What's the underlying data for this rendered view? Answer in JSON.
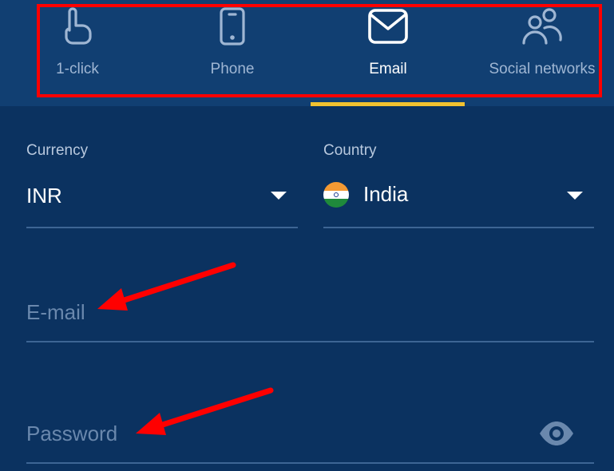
{
  "tabs": [
    {
      "label": "1-click",
      "icon": "hand-pointer-icon",
      "active": false
    },
    {
      "label": "Phone",
      "icon": "phone-icon",
      "active": false
    },
    {
      "label": "Email",
      "icon": "envelope-icon",
      "active": true
    },
    {
      "label": "Social networks",
      "icon": "people-icon",
      "active": false
    }
  ],
  "form": {
    "currency": {
      "label": "Currency",
      "value": "INR"
    },
    "country": {
      "label": "Country",
      "value": "India"
    },
    "email": {
      "placeholder": "E-mail",
      "value": ""
    },
    "password": {
      "placeholder": "Password",
      "value": ""
    }
  },
  "colors": {
    "background": "#0b3260",
    "tab_bar": "#113f72",
    "active_indicator": "#f2c230",
    "annotation": "#ff0000"
  }
}
